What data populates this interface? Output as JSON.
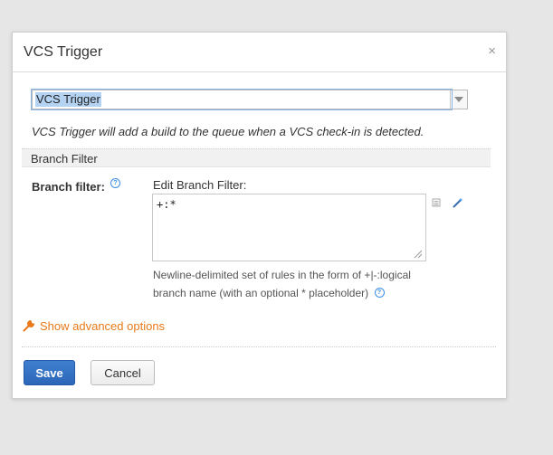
{
  "dialog": {
    "title": "VCS Trigger",
    "close_glyph": "×"
  },
  "trigger_select": {
    "selected": "VCS Trigger"
  },
  "description": "VCS Trigger will add a build to the queue when a VCS check-in is detected.",
  "section": {
    "title": "Branch Filter"
  },
  "branch_filter": {
    "label": "Branch filter:",
    "edit_label": "Edit Branch Filter:",
    "value": "+:*",
    "hint": "Newline-delimited set of rules in the form of +|-:logical branch name (with an optional * placeholder)"
  },
  "advanced": {
    "label": "Show advanced options"
  },
  "buttons": {
    "save": "Save",
    "cancel": "Cancel"
  },
  "colors": {
    "accent": "#2c66b8",
    "link": "#e8791a",
    "help": "#3a8ee6"
  },
  "icons": [
    "close-icon",
    "chevron-down-icon",
    "help-icon",
    "list-icon",
    "magic-wand-icon",
    "resize-grip-icon",
    "wrench-icon"
  ]
}
